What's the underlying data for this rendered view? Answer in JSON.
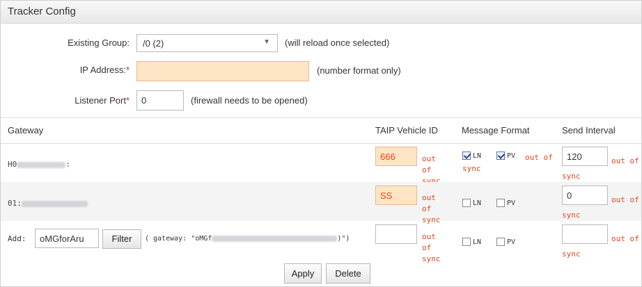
{
  "panel": {
    "title": "Tracker Config"
  },
  "form": {
    "existing_group": {
      "label": "Existing Group:",
      "value": "/0 (2)",
      "hint": "(will reload once selected)"
    },
    "ip_address": {
      "label": "IP Address:",
      "required_mark": "*",
      "value": "",
      "hint": "(number format only)"
    },
    "listener_port": {
      "label": "Listener Port",
      "required_mark": "*",
      "value": "0",
      "hint": "(firewall needs to be opened)"
    }
  },
  "table": {
    "headers": {
      "gateway": "Gateway",
      "taip_vehicle_id": "TAIP Vehicle ID",
      "message_format": "Message Format",
      "send_interval": "Send Interval"
    },
    "rows": [
      {
        "gateway_prefix": "H0",
        "gateway_suffix": ":",
        "vehicle_id": "666",
        "vehicle_status": "out of sync",
        "ln_checked": true,
        "pv_checked": true,
        "format_status": "out of sync",
        "interval": "120",
        "interval_status": "out of sync"
      },
      {
        "gateway_prefix": "01:",
        "gateway_suffix": "",
        "vehicle_id": "SS",
        "vehicle_status": "out of sync",
        "ln_checked": false,
        "pv_checked": false,
        "format_status": "",
        "interval": "0",
        "interval_status": "out of sync"
      }
    ],
    "checkbox_labels": {
      "ln": "LN",
      "pv": "PV"
    },
    "add_row": {
      "label": "Add:",
      "gateway_value": "oMGforAru",
      "filter_button": "Filter",
      "gateway_hint_prefix": "( gateway: \"oMGf",
      "gateway_hint_suffix": ")\")",
      "vehicle_id": "",
      "vehicle_status": "out of sync",
      "ln_checked": false,
      "pv_checked": false,
      "interval": "",
      "interval_status": "out of sync"
    }
  },
  "actions": {
    "apply": "Apply",
    "delete": "Delete"
  },
  "colors": {
    "required": "#d3242c",
    "out_of_sync": "#e0471c",
    "required_field_bg": "#fde5c5"
  }
}
